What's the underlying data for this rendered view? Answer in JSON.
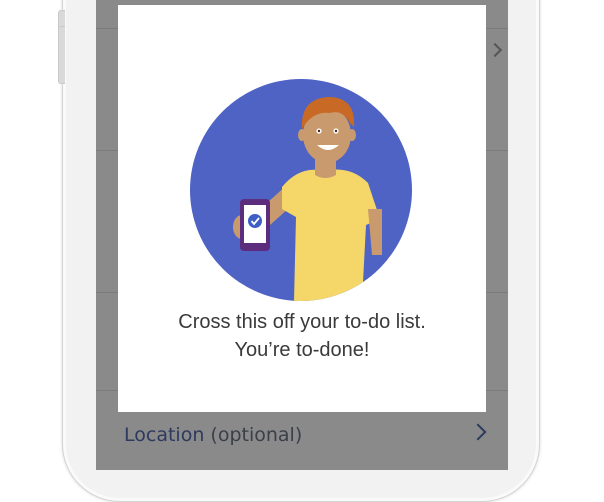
{
  "modal": {
    "message_line1": "Cross this off your to-do list.",
    "message_line2": "You’re to-done!",
    "illustration_icon": "person-holding-phone-checkmark-icon"
  },
  "form": {
    "location_label": "Location",
    "location_hint": "(optional)",
    "location_chevron_icon": "chevron-right-icon"
  },
  "colors": {
    "circle_blue": "#4e63c3",
    "shirt_yellow": "#f5d769",
    "hair_orange": "#c86a25",
    "skin": "#c99a6e",
    "phone_purple": "#5c2d7d",
    "check_blue": "#3d5fc6",
    "overlay_gray": "#8a8a8a",
    "label_navy": "#2d3a5e"
  }
}
